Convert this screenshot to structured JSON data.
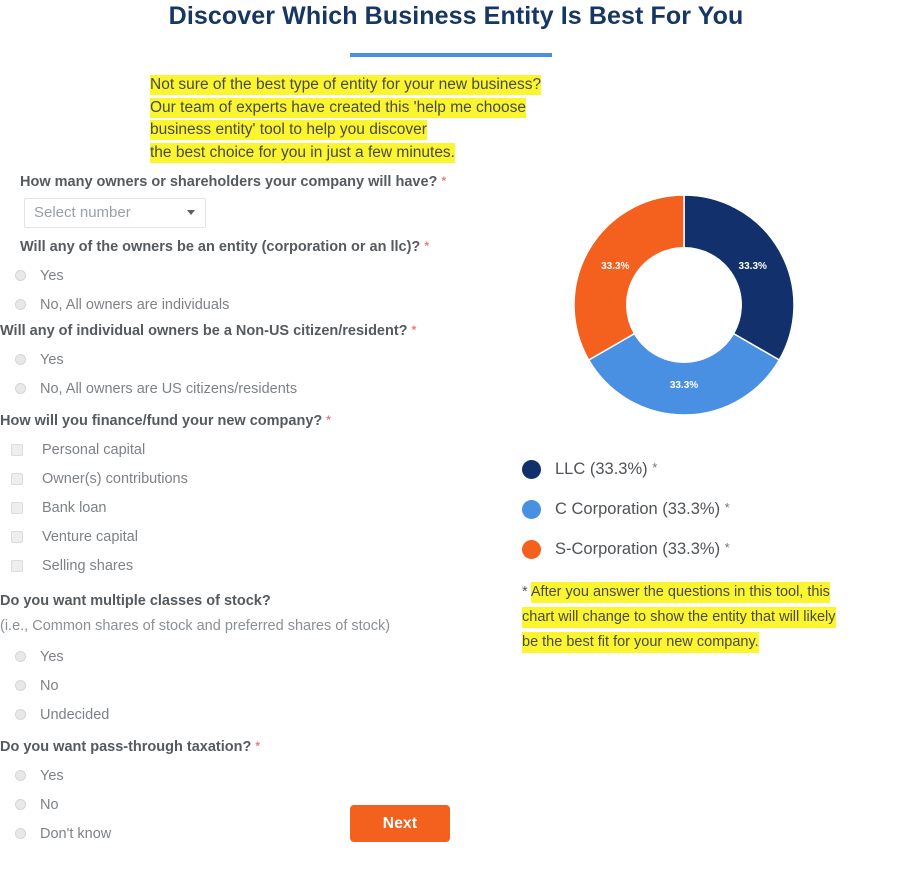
{
  "header": {
    "title": "Discover Which Business Entity Is Best For You",
    "divider_color": "#4a90e2",
    "title_color": "#173763"
  },
  "intro": {
    "line1": "Not sure of the best type of entity for your new business?",
    "line2": "Our team of experts have created this 'help me choose",
    "line3": "business entity' tool to help you discover",
    "line4": "the best choice for you in just a few minutes.",
    "highlight_color": "#faf52e"
  },
  "form": {
    "q1": {
      "label": "How many owners or shareholders your company will have?",
      "required_mark": "*",
      "select_value": "Select number"
    },
    "q2": {
      "label": "Will any of the owners be an entity (corporation or an llc)?",
      "required_mark": "*",
      "options": [
        {
          "label": "Yes"
        },
        {
          "label": "No, All owners are individuals"
        }
      ]
    },
    "q3": {
      "label": "Will any of individual owners be a Non-US citizen/resident?",
      "required_mark": "*",
      "options": [
        {
          "label": "Yes"
        },
        {
          "label": "No, All owners are US citizens/residents"
        }
      ]
    },
    "q4": {
      "label": "How will you finance/fund your new company?",
      "required_mark": "*",
      "options": [
        {
          "label": "Personal capital"
        },
        {
          "label": "Owner(s) contributions"
        },
        {
          "label": "Bank loan"
        },
        {
          "label": "Venture capital"
        },
        {
          "label": "Selling shares"
        }
      ]
    },
    "q5": {
      "label": "Do you want multiple classes of stock?",
      "sublabel": "(i.e., Common shares of stock and preferred shares of stock)",
      "options": [
        {
          "label": "Yes"
        },
        {
          "label": "No"
        },
        {
          "label": "Undecided"
        }
      ]
    },
    "q6": {
      "label": "Do you want pass-through taxation?",
      "required_mark": "*",
      "options": [
        {
          "label": "Yes"
        },
        {
          "label": "No"
        },
        {
          "label": "Don't know"
        }
      ]
    },
    "next_button": "Next",
    "next_button_color": "#f4601e"
  },
  "chart_data": {
    "type": "pie",
    "variant": "donut",
    "title": "",
    "categories": [
      "LLC",
      "C Corporation",
      "S-Corporation"
    ],
    "values": [
      33.3,
      33.3,
      33.3
    ],
    "value_labels": [
      "33.3%",
      "33.3%",
      "33.3%"
    ],
    "colors": [
      "#12306b",
      "#4a90e2",
      "#f4601e"
    ],
    "legend_position": "bottom",
    "legend": [
      {
        "label": "LLC (33.3%)",
        "footnote_mark": "*",
        "color": "#12306b"
      },
      {
        "label": "C Corporation (33.3%)",
        "footnote_mark": "*",
        "color": "#4a90e2"
      },
      {
        "label": "S-Corporation (33.3%)",
        "footnote_mark": "*",
        "color": "#f4601e"
      }
    ],
    "grid": false,
    "start_angle_deg": 0,
    "inner_radius_ratio": 0.52
  },
  "chart_footnote": {
    "star": "*",
    "line1": "After you answer the questions in this tool, this",
    "line2": "chart will change to show the entity that will likely",
    "line3": "be the best fit for your new company.",
    "highlight_color": "#faf52e"
  }
}
